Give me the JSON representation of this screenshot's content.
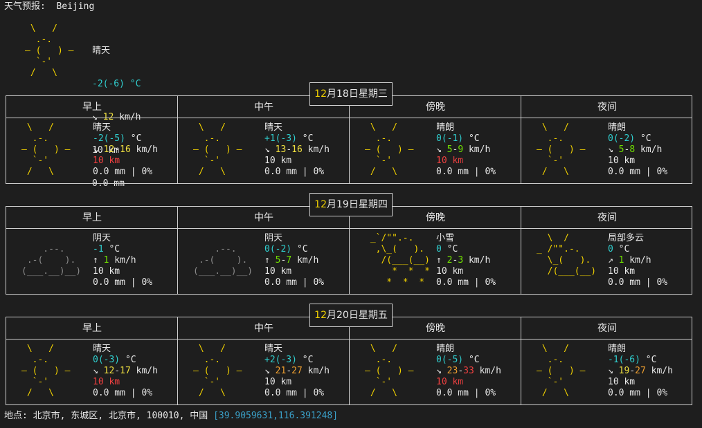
{
  "title_line": "天气预报:  Beijing",
  "current": {
    "condition": "晴天",
    "temp": "-2(-6) °C",
    "wind_dir": "↘",
    "wind": "12",
    "wind_unit": "km/h",
    "visibility": "10 km",
    "precip": "0.0 mm"
  },
  "periods": [
    "早上",
    "中午",
    "傍晚",
    "夜间"
  ],
  "days": [
    {
      "date_num": "12",
      "date_rest": "月18日星期三",
      "slots": [
        {
          "art": "sun",
          "condition": "晴天",
          "temp_a": "-2",
          "temp_b": "(-5)",
          "wind_dir": "↘",
          "wind_a": "12",
          "wind_b": "16",
          "vis": "10 km",
          "vis_red": true,
          "precip": "0.0 mm | 0%"
        },
        {
          "art": "sun",
          "condition": "晴天",
          "temp_a": "+1",
          "temp_b": "(-3)",
          "wind_dir": "↘",
          "wind_a": "13",
          "wind_b": "16",
          "vis": "10 km",
          "vis_red": false,
          "precip": "0.0 mm | 0%"
        },
        {
          "art": "sun",
          "condition": "晴朗",
          "temp_a": "0",
          "temp_b": "(-1)",
          "wind_dir": "↘",
          "wind_a": "5",
          "wind_b": "9",
          "vis": "10 km",
          "vis_red": true,
          "precip": "0.0 mm | 0%"
        },
        {
          "art": "sun",
          "condition": "晴朗",
          "temp_a": "0",
          "temp_b": "(-2)",
          "wind_dir": "↘",
          "wind_a": "5",
          "wind_b": "8",
          "vis": "10 km",
          "vis_red": false,
          "precip": "0.0 mm | 0%"
        }
      ]
    },
    {
      "date_num": "12",
      "date_rest": "月19日星期四",
      "slots": [
        {
          "art": "cloud",
          "condition": "阴天",
          "temp_a": "-1",
          "temp_b": "",
          "wind_dir": "↑",
          "wind_a": "1",
          "wind_b": "",
          "vis": "10 km",
          "vis_red": false,
          "precip": "0.0 mm | 0%"
        },
        {
          "art": "cloud",
          "condition": "阴天",
          "temp_a": "0",
          "temp_b": "(-2)",
          "wind_dir": "↑",
          "wind_a": "5",
          "wind_b": "7",
          "vis": "10 km",
          "vis_red": false,
          "precip": "0.0 mm | 0%"
        },
        {
          "art": "snow",
          "condition": "小雪",
          "temp_a": "0",
          "temp_b": "",
          "wind_dir": "↑",
          "wind_a": "2",
          "wind_b": "3",
          "vis": "10 km",
          "vis_red": false,
          "precip": "0.0 mm | 0%"
        },
        {
          "art": "partly",
          "condition": "局部多云",
          "temp_a": "0",
          "temp_b": "",
          "wind_dir": "↗",
          "wind_a": "1",
          "wind_b": "",
          "vis": "10 km",
          "vis_red": false,
          "precip": "0.0 mm | 0%"
        }
      ]
    },
    {
      "date_num": "12",
      "date_rest": "月20日星期五",
      "slots": [
        {
          "art": "sun",
          "condition": "晴天",
          "temp_a": "0",
          "temp_b": "(-3)",
          "wind_dir": "↘",
          "wind_a": "12",
          "wind_b": "17",
          "vis": "10 km",
          "vis_red": true,
          "precip": "0.0 mm | 0%"
        },
        {
          "art": "sun",
          "condition": "晴天",
          "temp_a": "+2",
          "temp_b": "(-3)",
          "wind_dir": "↘",
          "wind_a": "21",
          "wind_b": "27",
          "vis": "10 km",
          "vis_red": false,
          "precip": "0.0 mm | 0%"
        },
        {
          "art": "sun",
          "condition": "晴朗",
          "temp_a": "0",
          "temp_b": "(-5)",
          "wind_dir": "↘",
          "wind_a": "23",
          "wind_b": "33",
          "vis": "10 km",
          "vis_red": true,
          "precip": "0.0 mm | 0%"
        },
        {
          "art": "sun",
          "condition": "晴朗",
          "temp_a": "-1",
          "temp_b": "(-6)",
          "wind_dir": "↘",
          "wind_a": "19",
          "wind_b": "27",
          "vis": "10 km",
          "vis_red": false,
          "precip": "0.0 mm | 0%"
        }
      ]
    }
  ],
  "location_prefix": "地点: 北京市, 东城区, 北京市, 100010, 中国 ",
  "coordinates": "[39.9059631,116.391248]"
}
